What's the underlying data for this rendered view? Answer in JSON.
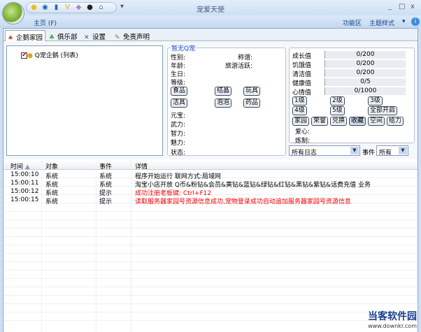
{
  "window": {
    "title": "宠爱天使",
    "minimize": "_",
    "maximize": "□",
    "close": "x"
  },
  "ribbon": {
    "home": "主页 (F)",
    "function_area": "功能区",
    "theme": "主题样式",
    "theme_arrow": "▾"
  },
  "tabs": [
    {
      "label": "企鹅家园",
      "icon": "penguin-icon"
    },
    {
      "label": "俱乐部",
      "icon": "tree-icon"
    },
    {
      "label": "设置",
      "icon": "tools-icon"
    },
    {
      "label": "免责声明",
      "icon": "scroll-icon"
    }
  ],
  "tree": {
    "item": "Q宠企鹅 (列表)"
  },
  "pet_info": {
    "group_label": "暂无Q宠",
    "fields": [
      "性别:",
      "年龄:",
      "生日:",
      "等级:",
      "元宝:",
      "武力:",
      "智力:",
      "魅力:",
      "状态:"
    ],
    "title_label": "称谓:",
    "travel_label": "旅游活跃:",
    "buttons": [
      "食品",
      "结晶",
      "玩具",
      "洁具",
      "泡泡",
      "药品"
    ]
  },
  "stats": {
    "rows": [
      {
        "label": "成长值",
        "value": "0/200"
      },
      {
        "label": "饥饿值",
        "value": "0/200"
      },
      {
        "label": "清洁值",
        "value": "0/200"
      },
      {
        "label": "健康值",
        "value": "0/5"
      },
      {
        "label": "心情值",
        "value": "0/1000"
      }
    ],
    "level_buttons": [
      "1级",
      "2级",
      "3级",
      "4级",
      "5级",
      "全部开启"
    ],
    "action_buttons": [
      "家园",
      "荣誉",
      "兑换",
      "收藏",
      "空间",
      "给力"
    ],
    "love_label": "爱心:",
    "forge_label": "炼制:"
  },
  "filters": {
    "log_filter": "所有日志",
    "event_label": "事件",
    "event_filter": "所有"
  },
  "log": {
    "columns": [
      "时间",
      "对象",
      "事件",
      "详情"
    ],
    "rows": [
      {
        "time": "15:00:10",
        "object": "系统",
        "event": "系统",
        "detail": "程序开始运行 联网方式:局域网",
        "red": false
      },
      {
        "time": "15:00:11",
        "object": "系统",
        "event": "系统",
        "detail": "淘宝小店开放 Q币&粉钻&会员&黄钻&蓝钻&绿钻&红钻&黑钻&紫钻&话费充值 业务",
        "red": false
      },
      {
        "time": "15:00:12",
        "object": "系统",
        "event": "提示",
        "detail": "成功注册老板键: Ctrl+F12",
        "red": true
      },
      {
        "time": "15:00:15",
        "object": "系统",
        "event": "提示",
        "detail": "读取服务器家园号资源信息成功,宠物登录成功自动追加服务器家园号资源信息",
        "red": true
      }
    ]
  },
  "watermark": {
    "name": "当客软件园",
    "url": "www.downkr.com"
  }
}
